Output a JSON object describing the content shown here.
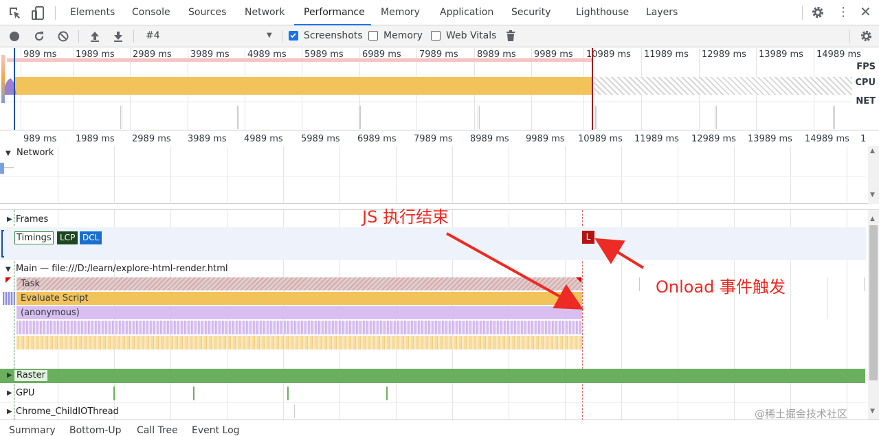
{
  "tabs": [
    {
      "label": "Elements"
    },
    {
      "label": "Console"
    },
    {
      "label": "Sources"
    },
    {
      "label": "Network"
    },
    {
      "label": "Performance",
      "active": true
    },
    {
      "label": "Memory"
    },
    {
      "label": "Application"
    },
    {
      "label": "Security"
    },
    {
      "label": "Lighthouse"
    },
    {
      "label": "Layers"
    }
  ],
  "toolbar": {
    "profile": "#4",
    "screenshots_label": "Screenshots",
    "screenshots_checked": true,
    "memory_label": "Memory",
    "memory_checked": false,
    "webvitals_label": "Web Vitals",
    "webvitals_checked": false
  },
  "overview": {
    "ticks": [
      "989 ms",
      "1989 ms",
      "2989 ms",
      "3989 ms",
      "4989 ms",
      "5989 ms",
      "6989 ms",
      "7989 ms",
      "8989 ms",
      "9989 ms",
      "10989 ms",
      "11989 ms",
      "12989 ms",
      "13989 ms",
      "14989 ms"
    ],
    "fps_label": "FPS",
    "cpu_label": "CPU",
    "net_label": "NET"
  },
  "ruler": {
    "ticks": [
      "989 ms",
      "1989 ms",
      "2989 ms",
      "3989 ms",
      "4989 ms",
      "5989 ms",
      "6989 ms",
      "7989 ms",
      "8989 ms",
      "9989 ms",
      "10989 ms",
      "11989 ms",
      "12989 ms",
      "13989 ms",
      "14989 ms",
      "1"
    ]
  },
  "network": {
    "label": "Network"
  },
  "tracks": {
    "frames": "Frames",
    "timings": "Timings",
    "lcp": "LCP",
    "dcl": "DCL",
    "load_marker": "L",
    "main": "Main — file:///D:/learn/explore-html-render.html",
    "task": "Task",
    "evaluate": "Evaluate Script",
    "anonymous": "(anonymous)",
    "raster": "Raster",
    "gpu": "GPU",
    "childio": "Chrome_ChildIOThread"
  },
  "annotations": {
    "js_end": "JS 执行结束",
    "onload": "Onload 事件触发"
  },
  "watermark": "@稀土掘金技术社区",
  "bottom_tabs": [
    {
      "label": "Summary"
    },
    {
      "label": "Bottom-Up"
    },
    {
      "label": "Call Tree"
    },
    {
      "label": "Event Log"
    }
  ],
  "colors": {
    "accent": "#1a73e8",
    "task": "#c8c8c8",
    "evaluate": "#f2c35a",
    "anonymous": "#d8bff0",
    "raster": "#6aaf5d",
    "annotation": "#ee2a24",
    "lcp": "#1e4620",
    "dcl": "#1a6fcd",
    "load": "#b31412"
  }
}
